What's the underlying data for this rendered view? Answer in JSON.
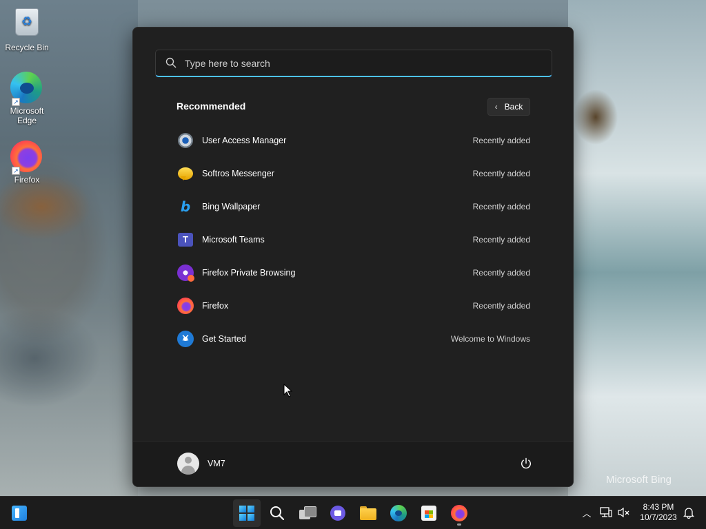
{
  "desktop": {
    "icons": [
      {
        "label": "Recycle Bin",
        "icon": "recycle-bin-icon"
      },
      {
        "label": "Microsoft Edge",
        "icon": "edge-icon"
      },
      {
        "label": "Firefox",
        "icon": "firefox-icon"
      }
    ],
    "watermark": "Microsoft Bing"
  },
  "start_menu": {
    "search": {
      "placeholder": "Type here to search",
      "value": ""
    },
    "recommended": {
      "title": "Recommended",
      "back_label": "Back",
      "items": [
        {
          "name": "User Access Manager",
          "status": "Recently added",
          "icon": "user-access-manager-icon"
        },
        {
          "name": "Softros Messenger",
          "status": "Recently added",
          "icon": "softros-messenger-icon"
        },
        {
          "name": "Bing Wallpaper",
          "status": "Recently added",
          "icon": "bing-icon"
        },
        {
          "name": "Microsoft Teams",
          "status": "Recently added",
          "icon": "teams-icon"
        },
        {
          "name": "Firefox Private Browsing",
          "status": "Recently added",
          "icon": "firefox-private-icon"
        },
        {
          "name": "Firefox",
          "status": "Recently added",
          "icon": "firefox-icon"
        },
        {
          "name": "Get Started",
          "status": "Welcome to Windows",
          "icon": "get-started-icon"
        }
      ]
    },
    "user": {
      "name": "VM7"
    },
    "power_icon": "power-icon"
  },
  "taskbar": {
    "apps": [
      "widgets",
      "start",
      "search",
      "task-view",
      "chat",
      "file-explorer",
      "edge",
      "store",
      "firefox"
    ],
    "tray": {
      "time": "8:43 PM",
      "date": "10/7/2023"
    }
  },
  "colors": {
    "menu_bg": "#202020",
    "accent": "#4cc2ff",
    "taskbar_bg": "#1c1c1c"
  }
}
